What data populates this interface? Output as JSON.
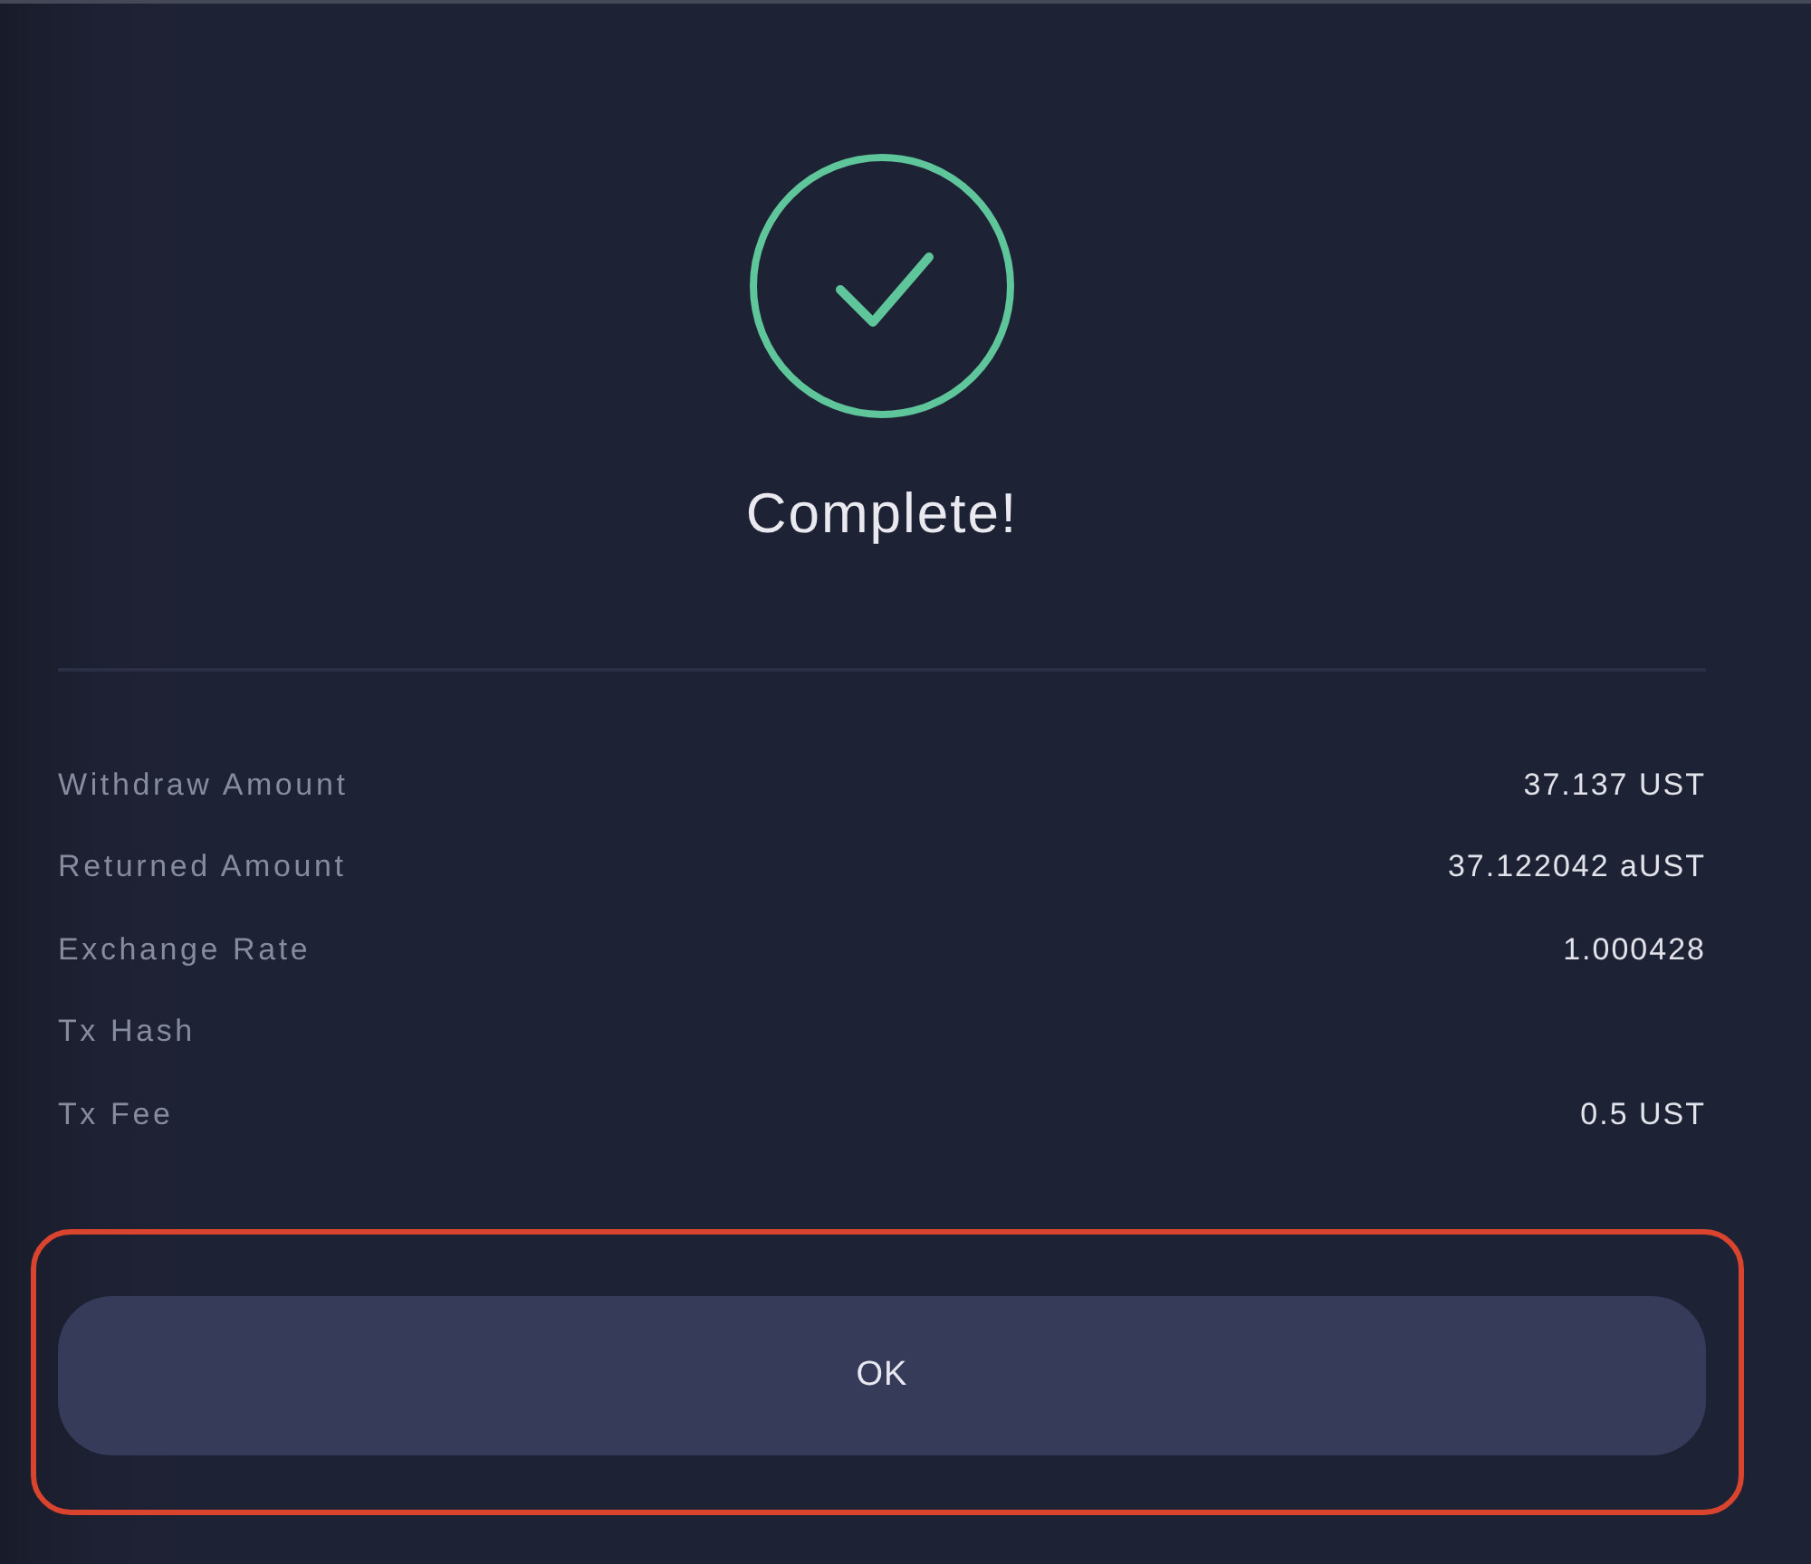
{
  "status": {
    "kind": "success",
    "title": "Complete!"
  },
  "details": [
    {
      "label": "Withdraw Amount",
      "value": "37.137 UST"
    },
    {
      "label": "Returned Amount",
      "value": "37.122042 aUST"
    },
    {
      "label": "Exchange Rate",
      "value": "1.000428"
    },
    {
      "label": "Tx Hash"
    },
    {
      "label": "Tx Fee",
      "value": "0.5 UST"
    }
  ],
  "ok_button": {
    "label": "OK",
    "highlighted": true
  }
}
